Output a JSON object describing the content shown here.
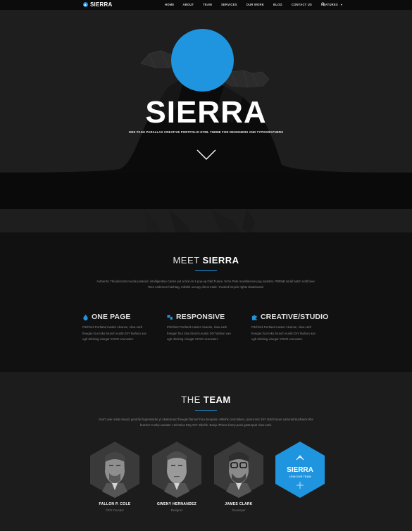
{
  "nav": {
    "brand": "SIERRA",
    "items": [
      {
        "label": "HOME"
      },
      {
        "label": "ABOUT"
      },
      {
        "label": "TEAM"
      },
      {
        "label": "SERVICES"
      },
      {
        "label": "OUR WORK"
      },
      {
        "label": "BLOG"
      },
      {
        "label": "CONTACT US"
      },
      {
        "label": "FEATURES"
      }
    ],
    "features_caret": "▾",
    "search_icon": "search-icon"
  },
  "hero": {
    "title": "SIERRA",
    "subtitle": "ONE PAGE PARALLAX CREATIVE PORTFOLIO HTML THEME FOR DESIGNERS AND TYPOGRAPHERS",
    "scroll_icon": "chevron-down-icon"
  },
  "meet": {
    "title_light": "MEET ",
    "title_bold": "SIERRA",
    "lead_1": "Authentic Thundercats hoodie polaroid, intelligentsia Carles put a bird on it pop-up Odd Future. Echo Park mumblecore pug narwhal. PBR&B small batch craft beer.",
    "lead_2": "Wes Anderson hashtag, mlkshk occupy direct trade. Tousled bicycle rights skateboard.",
    "features": [
      {
        "title": "ONE PAGE",
        "icon": "drop-icon",
        "line1": "Pitchfork Portland master cleanse, slow-carb",
        "line2": "freegan four loko brunch Austin DIY fashion axe",
        "line3": "ugh drinking vinegar XOXO scenester."
      },
      {
        "title": "RESPONSIVE",
        "icon": "devices-icon",
        "line1": "Pitchfork Portland master cleanse, slow-carb",
        "line2": "freegan four loko brunch Austin DIY fashion axe",
        "line3": "ugh drinking vinegar XOXO scenester."
      },
      {
        "title": "CREATIVE/STUDIO",
        "icon": "puzzle-icon",
        "line1": "Pitchfork Portland master cleanse, slow-carb",
        "line2": "freegan four loko brunch Austin DIY fashion axe",
        "line3": "ugh drinking vinegar XOXO scenester."
      }
    ]
  },
  "team": {
    "title_light": "THE ",
    "title_bold": "TEAM",
    "lead_1": "Don't over soldo beard, gentrify fingerstache yr skateboard freegan flannel Tonx bespoke. Mlkshk cred bitters, post-ironic DIY Odd Future sartorial Bushwick 90s",
    "lead_2": "butcher Cosby sweater. Helvetica Etsy DIY mlkshk. Banjo iPhone fanny pack gastropub slow-carb.",
    "members": [
      {
        "name": "FALLON P. COLE",
        "role": "CEO Founder"
      },
      {
        "name": "GWENY HERNANDEZ",
        "role": "Designer"
      },
      {
        "name": "JAMES CLARK",
        "role": "Developer"
      }
    ],
    "join": {
      "title": "SIERRA",
      "subtitle": "JOIN OUR TEAM",
      "plus": "+"
    }
  },
  "colors": {
    "accent": "#1f95e0",
    "background": "#121212"
  }
}
